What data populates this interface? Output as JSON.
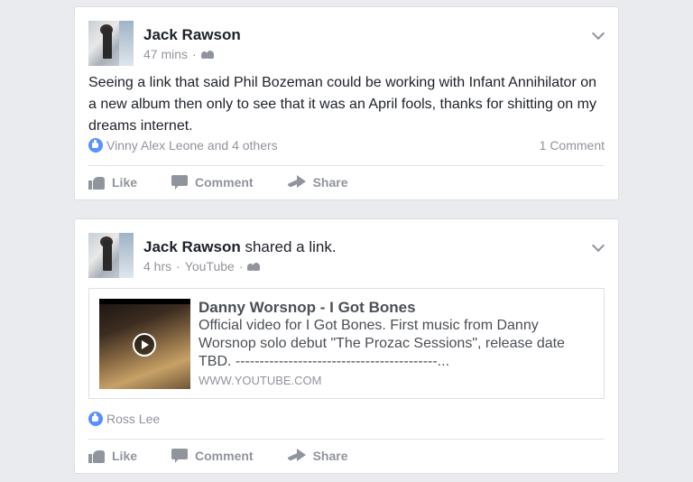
{
  "posts": [
    {
      "author": "Jack Rawson",
      "time": "47 mins",
      "separator": "·",
      "audience_icon": "friends-icon",
      "text": "Seeing a link that said Phil Bozeman could be working with Infant Annihilator on a new album then only to see that it was an April fools, thanks for shitting on my dreams internet.",
      "reactions": "Vinny Alex Leone and 4 others",
      "comments": "1 Comment",
      "actions": {
        "like": "Like",
        "comment": "Comment",
        "share": "Share"
      }
    },
    {
      "author": "Jack Rawson",
      "action_text": "shared a link.",
      "time": "4 hrs",
      "source": "YouTube",
      "separator": "·",
      "audience_icon": "friends-icon",
      "link": {
        "title": "Danny Worsnop - I Got Bones",
        "description": "Official video for I Got Bones. First music from Danny Worsnop solo debut \"The Prozac Sessions\", release date TBD. ------------------------------------------...",
        "domain": "WWW.YOUTUBE.COM"
      },
      "reactions": "Ross Lee",
      "actions": {
        "like": "Like",
        "comment": "Comment",
        "share": "Share"
      }
    }
  ],
  "colors": {
    "background": "#e9ebee",
    "accent": "#5890ff",
    "muted": "#90949c"
  }
}
